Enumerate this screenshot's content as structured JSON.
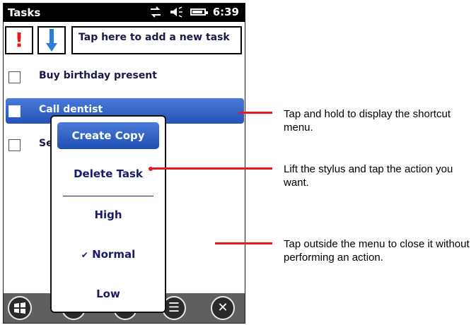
{
  "statusbar": {
    "title": "Tasks",
    "time": "6:39",
    "icons": [
      "sync-icon",
      "volume-icon",
      "battery-icon"
    ]
  },
  "toolbar": {
    "priority_high": "!",
    "priority_low_icon": "down-arrow-icon",
    "add_task_prompt": "Tap here to add a new task"
  },
  "tasks": [
    {
      "label": "Buy birthday present",
      "selected": false
    },
    {
      "label": "Call dentist",
      "selected": true
    },
    {
      "label": "Se",
      "selected": false
    }
  ],
  "context_menu": {
    "items": [
      {
        "label": "Create Copy",
        "highlighted": true
      },
      {
        "label": "Delete Task",
        "highlighted": false
      },
      {
        "label": "High",
        "highlighted": false,
        "checked": false
      },
      {
        "label": "Normal",
        "highlighted": false,
        "checked": true
      },
      {
        "label": "Low",
        "highlighted": false,
        "checked": false
      }
    ],
    "check_mark": "✔"
  },
  "bottombar": {
    "buttons": [
      "windows-start-icon",
      "keyboard-icon",
      "keyboard-icon",
      "menu-icon",
      "close-icon"
    ]
  },
  "callouts": [
    "Tap and hold to display the shortcut menu.",
    "Lift the stylus and tap the action you want.",
    "Tap outside the menu to close it without performing an action."
  ],
  "colors": {
    "accent": "#2453b8",
    "callout": "#e4181d",
    "text_dark": "#1a1a6a"
  }
}
